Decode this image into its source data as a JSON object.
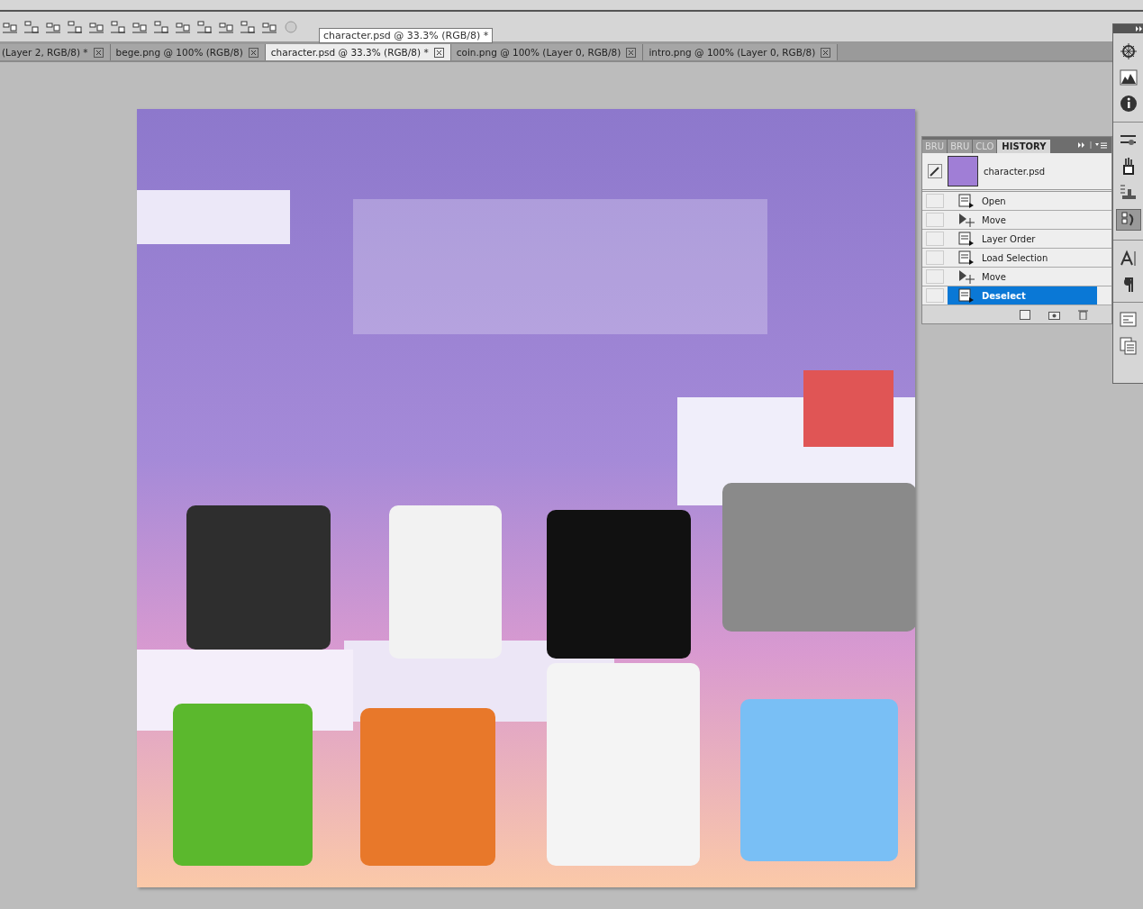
{
  "document_tabs": [
    {
      "label": "(Layer 2, RGB/8) *",
      "selected": false
    },
    {
      "label": "bege.png @ 100% (RGB/8)",
      "selected": false
    },
    {
      "label": "character.psd @ 33.3% (RGB/8) *",
      "selected": true
    },
    {
      "label": "coin.png @ 100% (Layer 0, RGB/8)",
      "selected": false
    },
    {
      "label": "intro.png @ 100% (Layer 0, RGB/8)",
      "selected": false
    }
  ],
  "tooltip": "character.psd @ 33.3% (RGB/8) *",
  "history_panel": {
    "tabs": [
      {
        "label": "BRU",
        "selected": false
      },
      {
        "label": "BRU",
        "selected": false
      },
      {
        "label": "CLO",
        "selected": false
      },
      {
        "label": "HISTORY",
        "selected": true
      }
    ],
    "snapshot": "character.psd",
    "items": [
      {
        "label": "Open",
        "kind": "document",
        "source": false,
        "selected": false
      },
      {
        "label": "Move",
        "kind": "move",
        "source": false,
        "selected": false
      },
      {
        "label": "Layer Order",
        "kind": "document",
        "source": false,
        "selected": false
      },
      {
        "label": "Load Selection",
        "kind": "document",
        "source": false,
        "selected": false
      },
      {
        "label": "Move",
        "kind": "move",
        "source": false,
        "selected": false
      },
      {
        "label": "Deselect",
        "kind": "document",
        "source": false,
        "selected": true
      }
    ]
  }
}
